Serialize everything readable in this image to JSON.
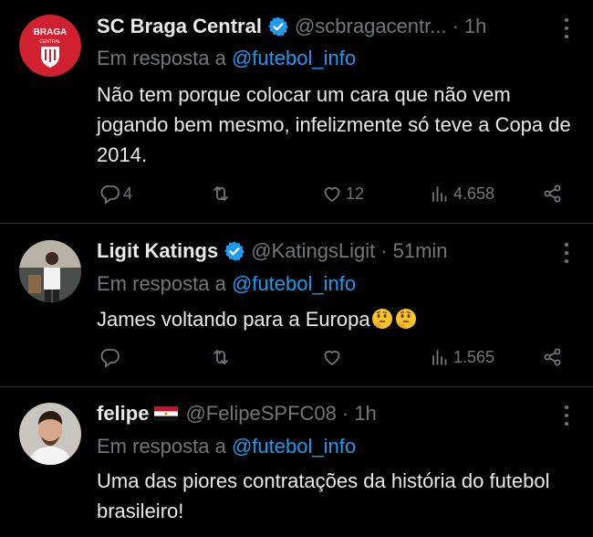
{
  "tweets": [
    {
      "name": "SC Braga Central",
      "handle": "@scbragacentr...",
      "time": "1h",
      "reply_prefix": "Em resposta a",
      "reply_mention": "@futebol_info",
      "text": "Não tem porque colocar um cara que não vem jogando bem mesmo, infelizmente só teve a Copa de 2014.",
      "replies": "4",
      "retweets": "",
      "likes": "12",
      "views": "4.658",
      "avatar": {
        "brand_text_top": "BRAGA",
        "brand_text_bottom": "CENTRAL",
        "color": "#d1202f"
      }
    },
    {
      "name": "Ligit Katings",
      "handle": "@KatingsLigit",
      "time": "51min",
      "reply_prefix": "Em resposta a",
      "reply_mention": "@futebol_info",
      "text": "James voltando para a Europa",
      "emoji": "thinking-face-icon",
      "replies": "",
      "retweets": "",
      "likes": "",
      "views": "1.565"
    },
    {
      "name": "felipe",
      "handle": "@FelipeSPFC08",
      "time": "1h",
      "reply_prefix": "Em resposta a",
      "reply_mention": "@futebol_info",
      "text": "Uma das piores contratações da história do futebol brasileiro!",
      "flag": "egypt-flag-icon"
    }
  ],
  "colors": {
    "background": "#000000",
    "text": "#e7e9ea",
    "muted": "#71767b",
    "link": "#1d9bf0",
    "verified": "#1d9bf0",
    "divider": "#2f3336"
  },
  "separator": "·"
}
